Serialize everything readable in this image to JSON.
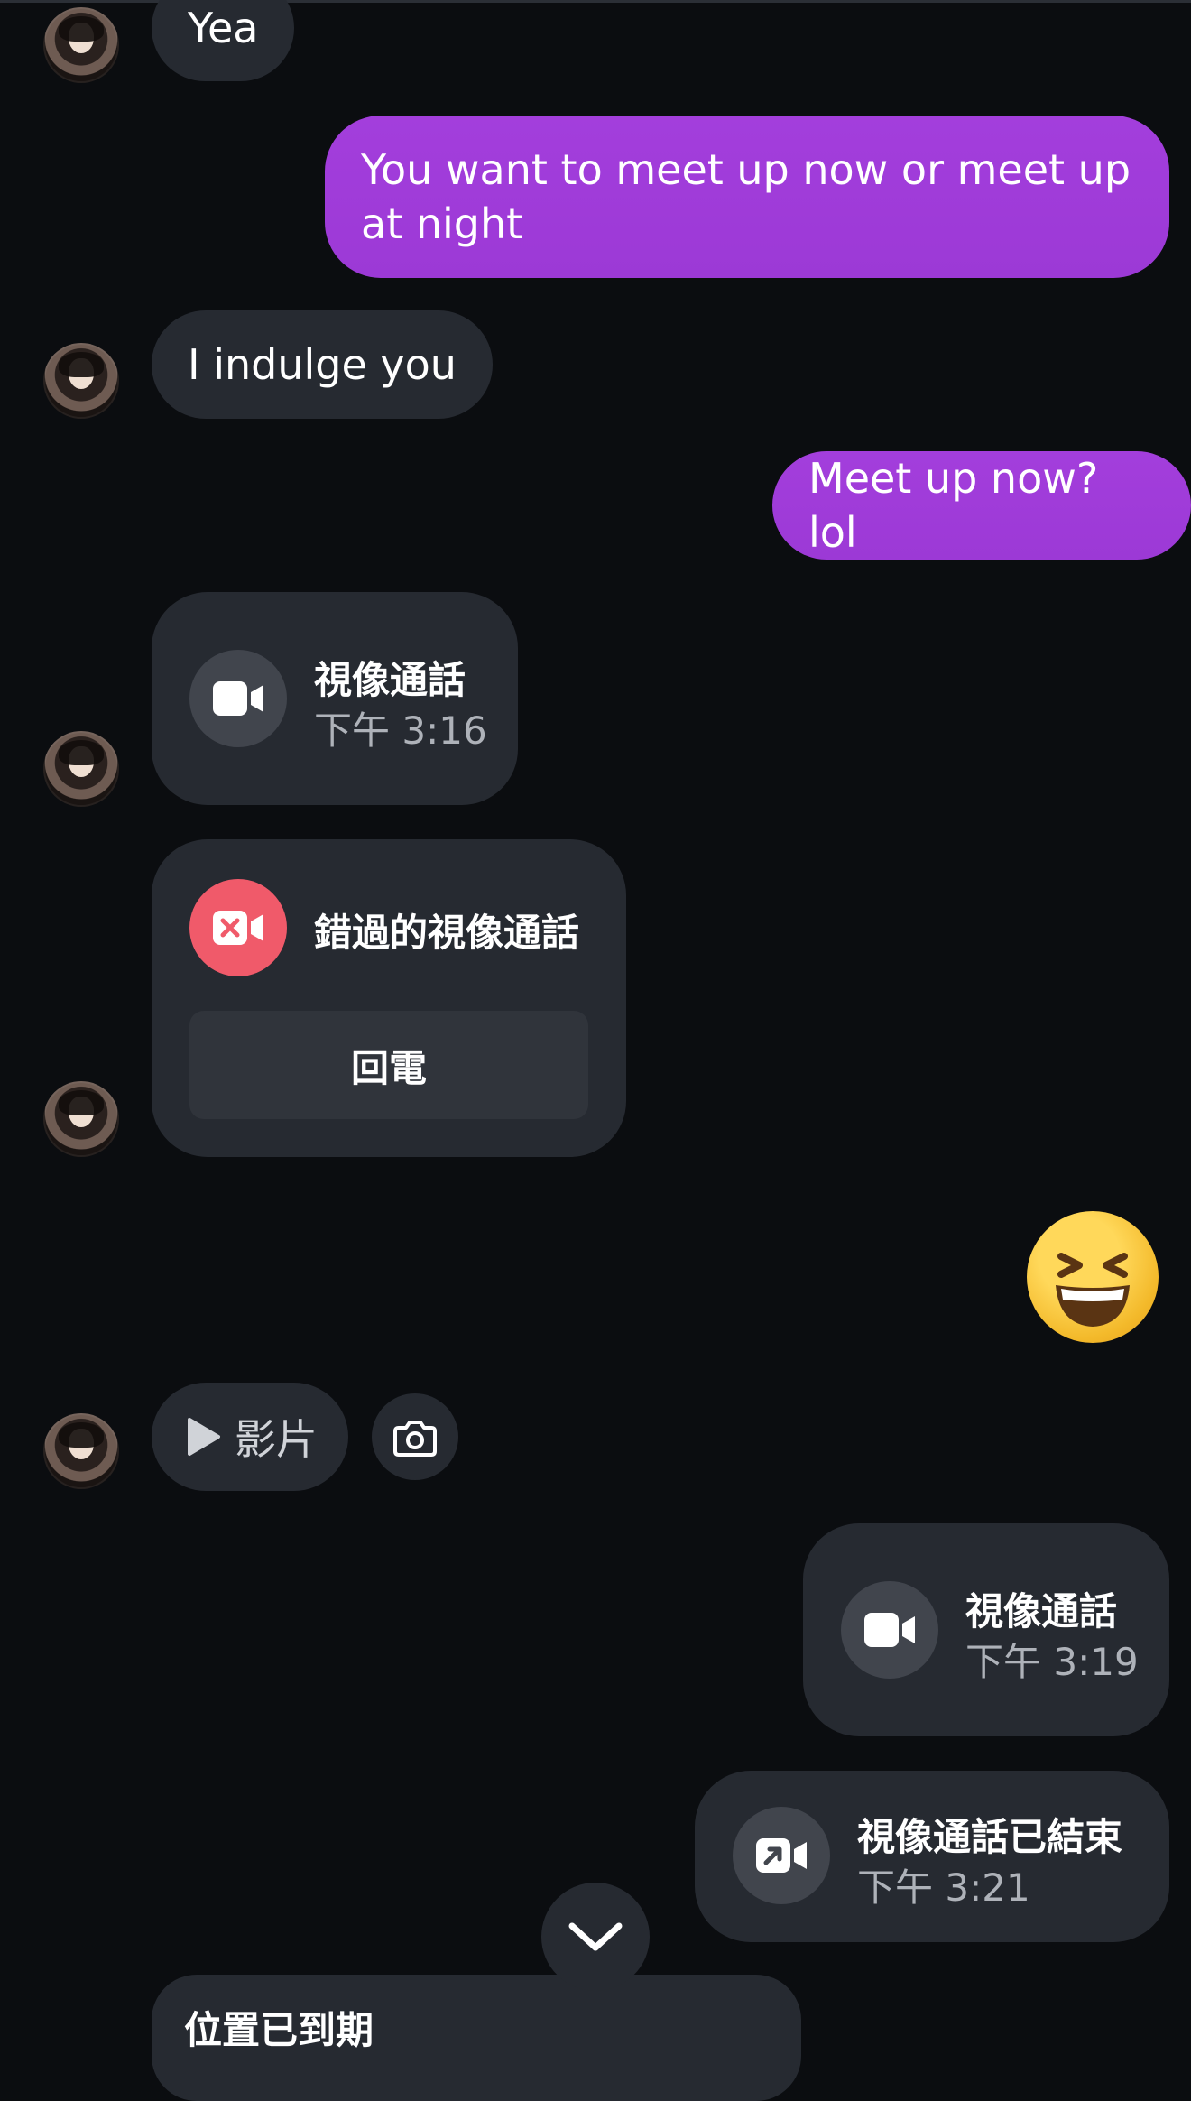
{
  "messages": [
    {
      "side": "incoming",
      "text": "Yea"
    },
    {
      "side": "outgoing",
      "text": "You want to meet up now or meet up at night"
    },
    {
      "side": "incoming",
      "text": "I indulge you"
    },
    {
      "side": "outgoing",
      "text": "Meet up now? lol"
    }
  ],
  "calls": {
    "incoming_video": {
      "title": "視像通話",
      "time": "下午 3:16"
    },
    "missed_video": {
      "title": "錯過的視像通話",
      "action": "回電"
    },
    "outgoing_video": {
      "title": "視像通話",
      "time": "下午 3:19"
    },
    "ended_video": {
      "title": "視像通話已結束",
      "time": "下午 3:21"
    }
  },
  "reaction_emoji": {
    "name": "grinning-squinting-face-emoji",
    "glyph": "😆"
  },
  "media": {
    "video_label": "影片",
    "camera_icon": "camera-icon",
    "play_icon": "play-icon"
  },
  "location": {
    "text": "位置已到期"
  },
  "icons": {
    "video": "video-camera-icon",
    "missed": "missed-video-icon",
    "ended": "video-ended-icon",
    "scroll": "chevron-down-icon"
  },
  "colors": {
    "background": "#0b0d10",
    "incoming_bubble": "#262a31",
    "outgoing_bubble": "#a33edc",
    "missed_call_red": "#f05a6a",
    "secondary_text": "#aeb2b9"
  }
}
